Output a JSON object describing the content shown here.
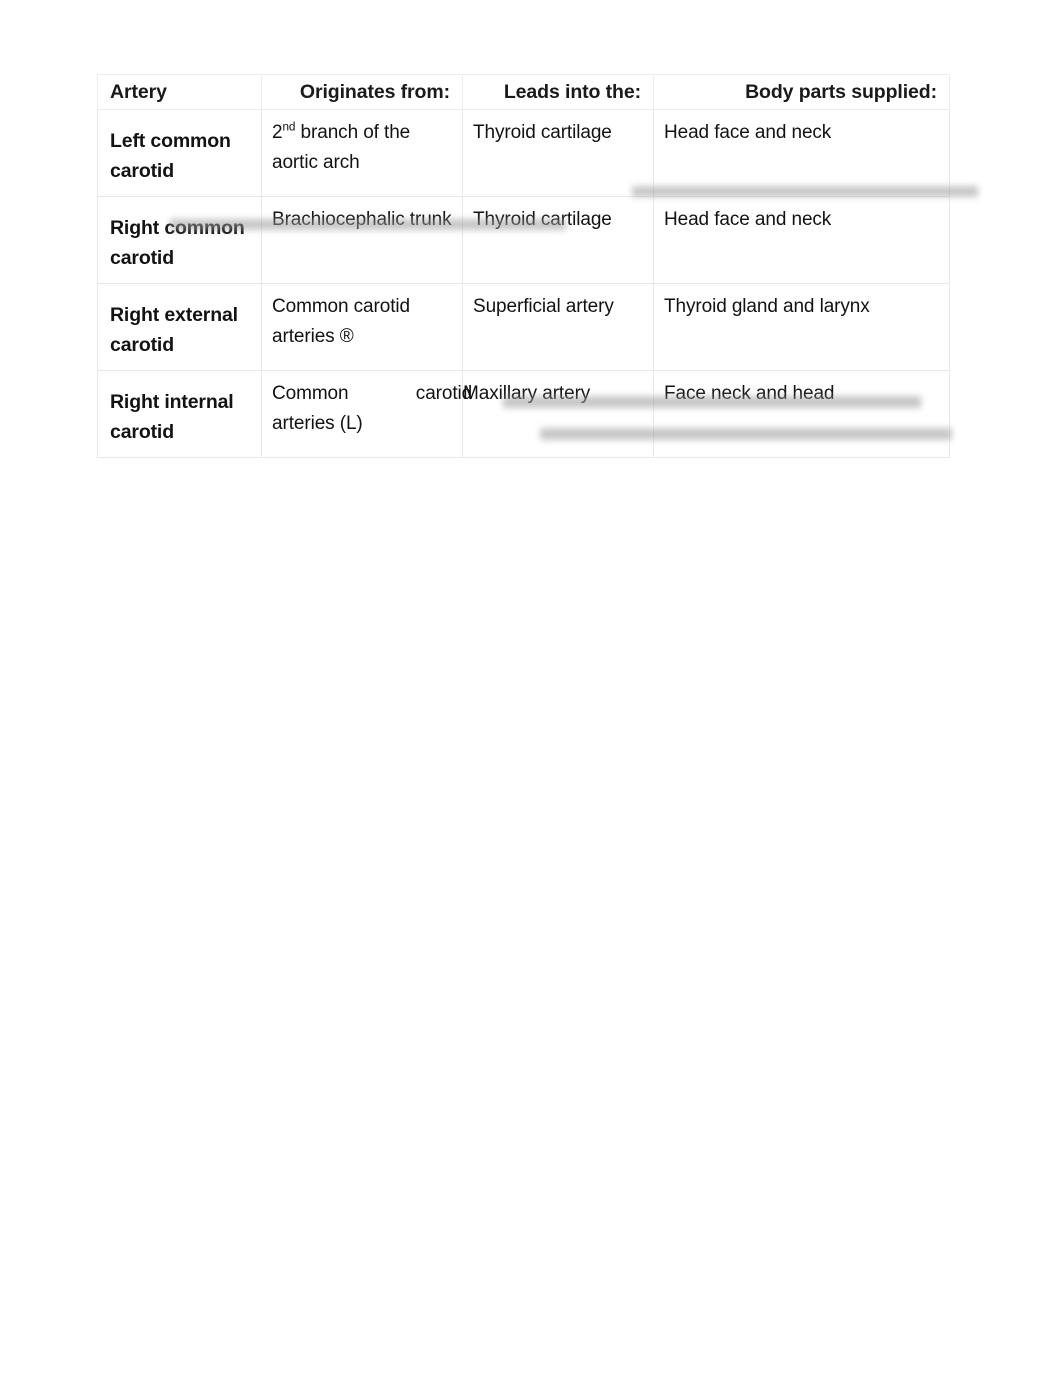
{
  "document": {
    "type": "table",
    "title": "Artery reference table"
  },
  "table": {
    "headers": [
      "Artery",
      "Originates from:",
      "Leads into the:",
      "Body parts supplied:"
    ],
    "rows": [
      {
        "artery": "Left common carotid",
        "originates_from_pre": "2",
        "originates_from_sup": "nd",
        "originates_from_post": " branch of the aortic arch",
        "leads_into": "Thyroid cartilage",
        "body_parts": "Head face and neck"
      },
      {
        "artery": "Right common carotid",
        "originates_from": "Brachiocephalic trunk",
        "leads_into": "Thyroid cartilage",
        "body_parts": "Head face and neck"
      },
      {
        "artery": "Right external carotid",
        "originates_from": "Common carotid arteries ®",
        "leads_into": "Superficial artery",
        "body_parts": "Thyroid gland and larynx"
      },
      {
        "artery": "Right internal carotid",
        "originates_from_line1": "Common             carotid",
        "originates_from_line2": "arteries (L)",
        "leads_into": "Maxillary artery",
        "body_parts": "Face neck and head"
      }
    ]
  },
  "colors": {
    "text": "#121212",
    "header_text": "#1a1a1a",
    "border": "#e8e8e8",
    "page_background": "#ffffff",
    "smudge": "#9b9b9b"
  }
}
